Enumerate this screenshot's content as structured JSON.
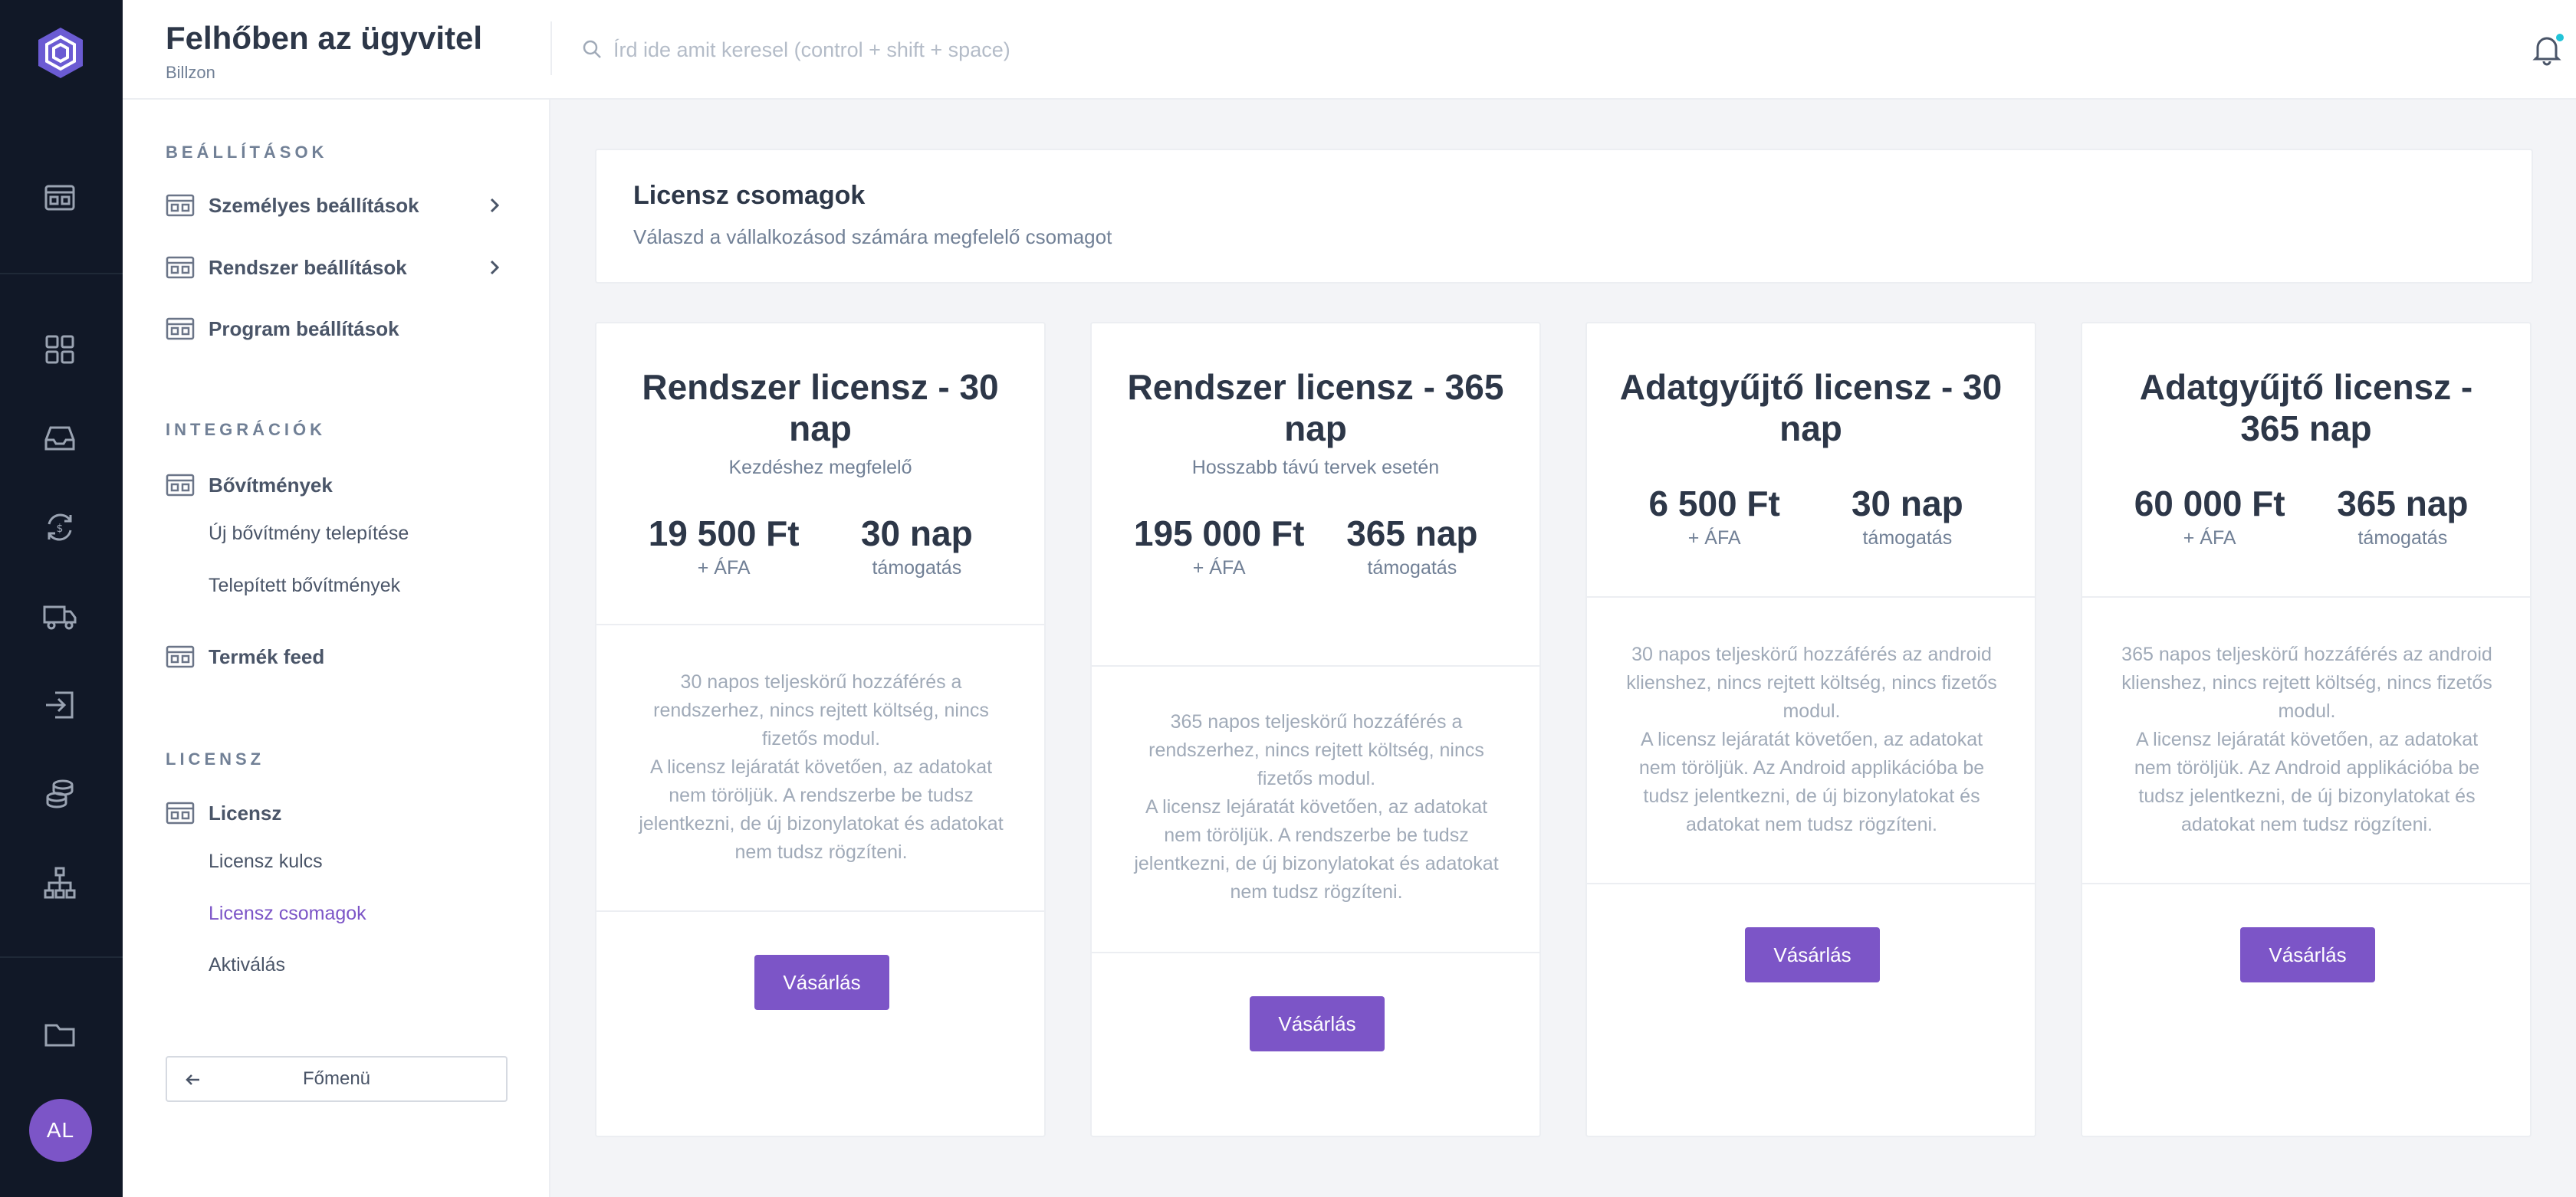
{
  "header": {
    "title": "Felhőben az ügyvitel",
    "subtitle": "Billzon",
    "search_placeholder": "Írd ide amit keresel (control + shift + space)"
  },
  "rail": {
    "avatar_initials": "AL",
    "icons": [
      "dashboard-icon",
      "grid-icon",
      "inbox-icon",
      "currency-exchange-icon",
      "truck-icon",
      "import-icon",
      "coins-icon",
      "sitemap-icon",
      "folder-icon"
    ]
  },
  "sidebar": {
    "sections": {
      "settings_title": "BEÁLLÍTÁSOK",
      "integrations_title": "INTEGRÁCIÓK",
      "license_title": "LICENSZ"
    },
    "items": {
      "personal": "Személyes beállítások",
      "system": "Rendszer beállítások",
      "program": "Program beállítások",
      "extensions": "Bővítmények",
      "install_extension": "Új bővítmény telepítése",
      "installed_extensions": "Telepített bővítmények",
      "product_feed": "Termék feed",
      "license": "Licensz",
      "license_key": "Licensz kulcs",
      "license_packages": "Licensz csomagok",
      "activation": "Aktiválás"
    },
    "back_label": "Főmenü"
  },
  "main": {
    "heading": "Licensz csomagok",
    "description": "Válaszd a vállalkozásod számára megfelelő csomagot",
    "buy_label": "Vásárlás",
    "packages": [
      {
        "name": "Rendszer licensz - 30 nap",
        "tagline": "Kezdéshez megfelelő",
        "price": "19 500 Ft",
        "price_note": "+ ÁFA",
        "duration": "30 nap",
        "duration_note": "támogatás",
        "desc1": "30 napos teljeskörű hozzáférés a rendszerhez, nincs rejtett költség, nincs fizetős modul.",
        "desc2": "A licensz lejáratát követően, az adatokat nem töröljük. A rendszerbe be tudsz jelentkezni, de új bizonylatokat és adatokat nem tudsz rögzíteni."
      },
      {
        "name": "Rendszer licensz - 365 nap",
        "tagline": "Hosszabb távú tervek esetén",
        "price": "195 000 Ft",
        "price_note": "+ ÁFA",
        "duration": "365 nap",
        "duration_note": "támogatás",
        "desc1": "365 napos teljeskörű hozzáférés a rendszerhez, nincs rejtett költség, nincs fizetős modul.",
        "desc2": "A licensz lejáratát követően, az adatokat nem töröljük. A rendszerbe be tudsz jelentkezni, de új bizonylatokat és adatokat nem tudsz rögzíteni."
      },
      {
        "name": "Adatgyűjtő licensz - 30 nap",
        "tagline": "",
        "price": "6 500 Ft",
        "price_note": "+ ÁFA",
        "duration": "30 nap",
        "duration_note": "támogatás",
        "desc1": "30 napos teljeskörű hozzáférés az android klienshez, nincs rejtett költség, nincs fizetős modul.",
        "desc2": "A licensz lejáratát követően, az adatokat nem töröljük. Az Android applikációba be tudsz jelentkezni, de új bizonylatokat és adatokat nem tudsz rögzíteni."
      },
      {
        "name": "Adatgyűjtő licensz - 365 nap",
        "tagline": "",
        "price": "60 000 Ft",
        "price_note": "+ ÁFA",
        "duration": "365 nap",
        "duration_note": "támogatás",
        "desc1": "365 napos teljeskörű hozzáférés az android klienshez, nincs rejtett költség, nincs fizetős modul.",
        "desc2": "A licensz lejáratát követően, az adatokat nem töröljük. Az Android applikációba be tudsz jelentkezni, de új bizonylatokat és adatokat nem tudsz rögzíteni."
      }
    ]
  },
  "colors": {
    "accent": "#7c55c7",
    "rail_bg": "#111827",
    "notification_dot": "#22c4d8"
  }
}
